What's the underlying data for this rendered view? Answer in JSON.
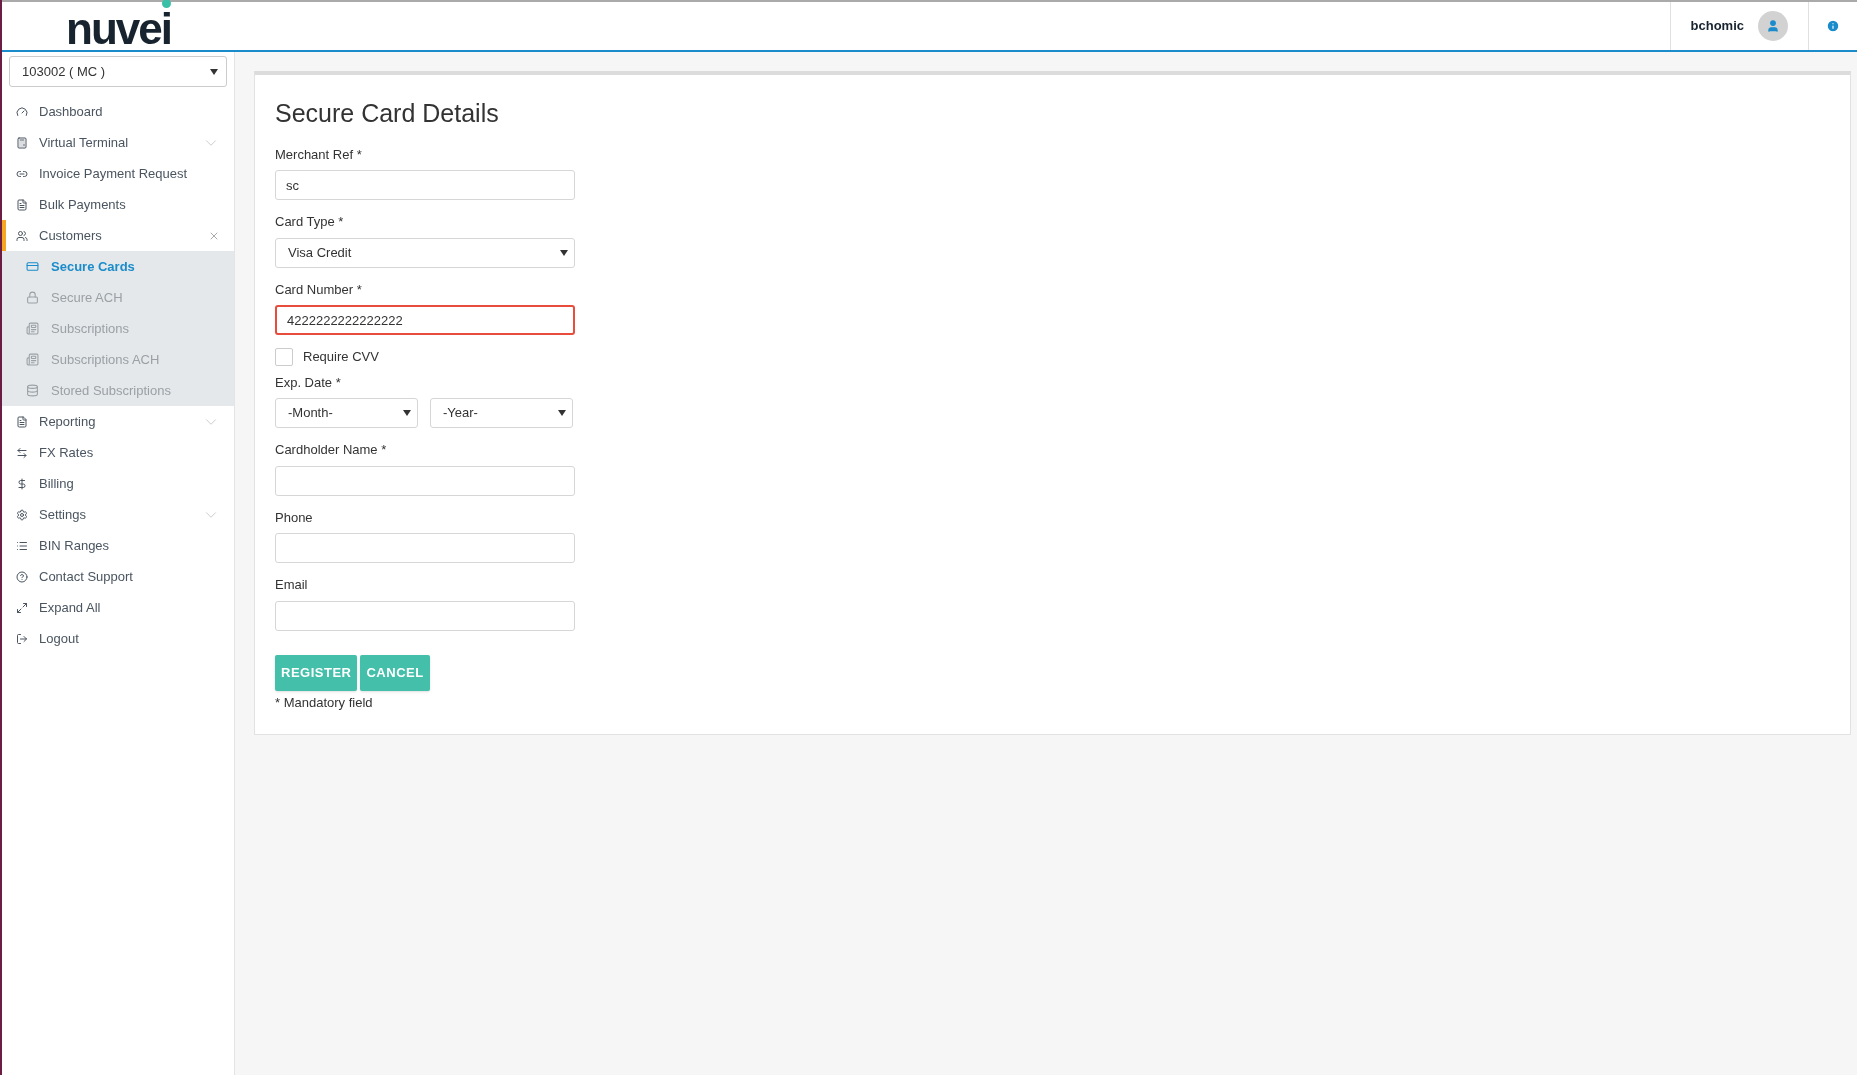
{
  "header": {
    "logo": "nuvei",
    "username": "bchomic"
  },
  "sidebar": {
    "account_select": {
      "value": "103002 ( MC )"
    },
    "items": [
      {
        "label": "Dashboard",
        "selected": false
      },
      {
        "label": "Virtual Terminal",
        "selected": false,
        "expanded": false
      },
      {
        "label": "Invoice Payment Request",
        "selected": false
      },
      {
        "label": "Bulk Payments",
        "selected": false
      },
      {
        "label": "Customers",
        "selected": true,
        "expanded": true,
        "children": [
          {
            "label": "Secure Cards",
            "selected": true
          },
          {
            "label": "Secure ACH",
            "selected": false
          },
          {
            "label": "Subscriptions",
            "selected": false
          },
          {
            "label": "Subscriptions ACH",
            "selected": false
          },
          {
            "label": "Stored Subscriptions",
            "selected": false
          }
        ]
      },
      {
        "label": "Reporting",
        "selected": false,
        "expanded": false
      },
      {
        "label": "FX Rates",
        "selected": false
      },
      {
        "label": "Billing",
        "selected": false
      },
      {
        "label": "Settings",
        "selected": false,
        "expanded": false
      },
      {
        "label": "BIN Ranges",
        "selected": false
      },
      {
        "label": "Contact Support",
        "selected": false
      },
      {
        "label": "Expand All",
        "selected": false
      },
      {
        "label": "Logout",
        "selected": false
      }
    ]
  },
  "form": {
    "title": "Secure Card Details",
    "fields": [
      {
        "kind": "text",
        "label": "Merchant Ref *",
        "value": "sc"
      },
      {
        "kind": "select",
        "label": "Card Type *",
        "value": "Visa Credit"
      },
      {
        "kind": "text",
        "label": "Card Number *",
        "value": "4222222222222222",
        "invalid": true
      },
      {
        "kind": "checkbox",
        "label": "Require CVV",
        "checked": false
      },
      {
        "kind": "date",
        "label": "Exp. Date *",
        "month": "-Month-",
        "year": "-Year-"
      },
      {
        "kind": "text",
        "label": "Cardholder Name *"
      },
      {
        "kind": "text",
        "label": "Phone"
      },
      {
        "kind": "text",
        "label": "Email"
      }
    ],
    "buttons": [
      "REGISTER",
      "CANCEL"
    ],
    "note": "* Mandatory field"
  }
}
